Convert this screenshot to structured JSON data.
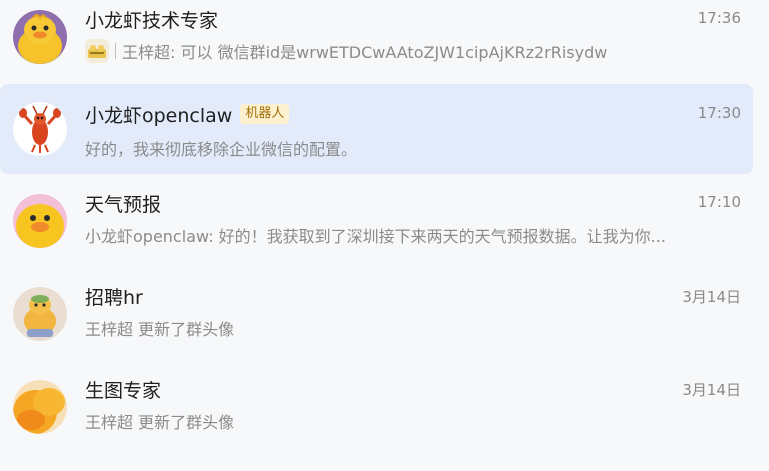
{
  "chats": [
    {
      "name": "小龙虾技术专家",
      "time": "17:36",
      "preview": "王梓超: 可以 微信群id是wrwETDCwAAtoZJW1cipAjKRz2rRisydw",
      "avatar_icon": "yellow-duck-icon"
    },
    {
      "name": "小龙虾openclaw",
      "badge": "机器人",
      "time": "17:30",
      "preview": "好的，我来彻底移除企业微信的配置。",
      "avatar_icon": "crayfish-icon"
    },
    {
      "name": "天气预报",
      "time": "17:10",
      "preview": "小龙虾openclaw: 好的！我获取到了深圳接下来两天的天气预报数据。让我为你...",
      "avatar_icon": "yellow-duck-icon"
    },
    {
      "name": "招聘hr",
      "time": "3月14日",
      "preview": "王梓超 更新了群头像",
      "avatar_icon": "duck-figure-icon"
    },
    {
      "name": "生图专家",
      "time": "3月14日",
      "preview": "王梓超 更新了群头像",
      "avatar_icon": "orange-duck-icon"
    }
  ],
  "colors": {
    "active_bg": "#e3ebfb",
    "badge_bg": "#fdf1cf",
    "badge_text": "#a0700a"
  }
}
